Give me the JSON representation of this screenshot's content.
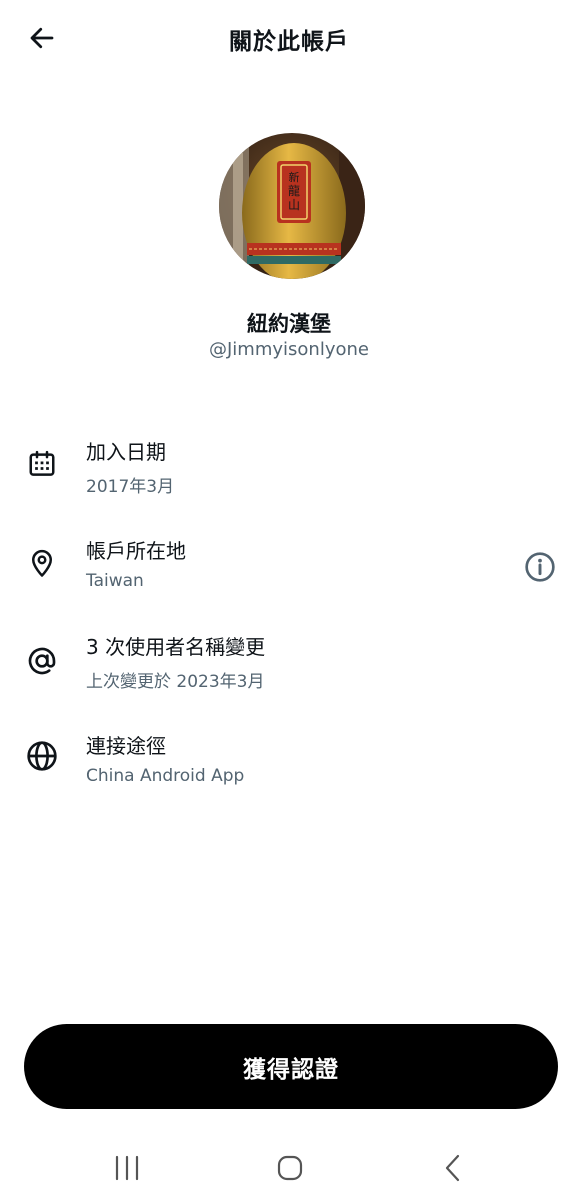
{
  "header": {
    "title": "關於此帳戶",
    "back_icon": "arrow-left-icon"
  },
  "profile": {
    "display_name": "紐約漢堡",
    "handle": "@Jimmyisonlyone",
    "avatar_icon": "temple-lantern-avatar"
  },
  "details": [
    {
      "icon": "calendar-icon",
      "label": "加入日期",
      "value": "2017年3月"
    },
    {
      "icon": "location-pin-icon",
      "label": "帳戶所在地",
      "value": "Taiwan",
      "info_icon": "info-icon"
    },
    {
      "icon": "at-sign-icon",
      "label": "3 次使用者名稱變更",
      "value": "上次變更於 2023年3月"
    },
    {
      "icon": "globe-icon",
      "label": "連接途徑",
      "value": "China Android App"
    }
  ],
  "actions": {
    "verify_label": "獲得認證"
  },
  "system_nav": {
    "recents_icon": "recents-icon",
    "home_icon": "home-icon",
    "back_icon": "nav-back-icon"
  },
  "colors": {
    "text_primary": "#0f1419",
    "text_secondary": "#536471",
    "button_bg": "#000000",
    "button_text": "#ffffff"
  }
}
